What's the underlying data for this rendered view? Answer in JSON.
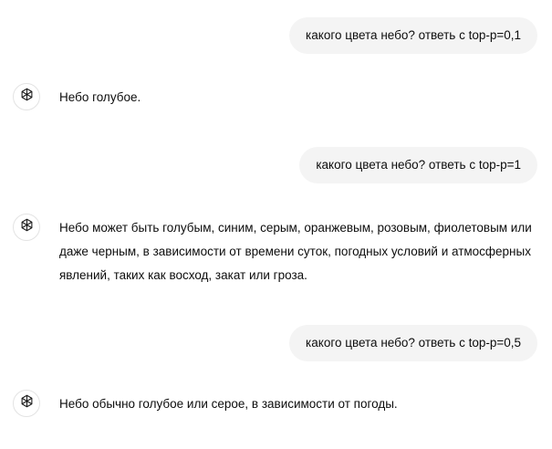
{
  "messages": [
    {
      "role": "user",
      "text": "какого цвета небо? ответь с top-p=0,1"
    },
    {
      "role": "assistant",
      "avatar_icon": "openai-logo-icon",
      "text": "Небо голубое."
    },
    {
      "role": "user",
      "text": "какого цвета небо? ответь с top-p=1"
    },
    {
      "role": "assistant",
      "avatar_icon": "openai-logo-icon",
      "text": "Небо может быть голубым, синим, серым, оранжевым, розовым, фиолетовым или даже черным, в зависимости от времени суток, погодных условий и атмосферных явлений, таких как восход, закат или гроза."
    },
    {
      "role": "user",
      "text": "какого цвета небо? ответь с top-p=0,5"
    },
    {
      "role": "assistant",
      "avatar_icon": "openai-logo-icon",
      "text": "Небо обычно голубое или серое, в зависимости от погоды."
    }
  ],
  "colors": {
    "user_bubble_bg": "#f4f4f4",
    "text": "#0d0d0d",
    "avatar_border": "#e3e3e3"
  }
}
